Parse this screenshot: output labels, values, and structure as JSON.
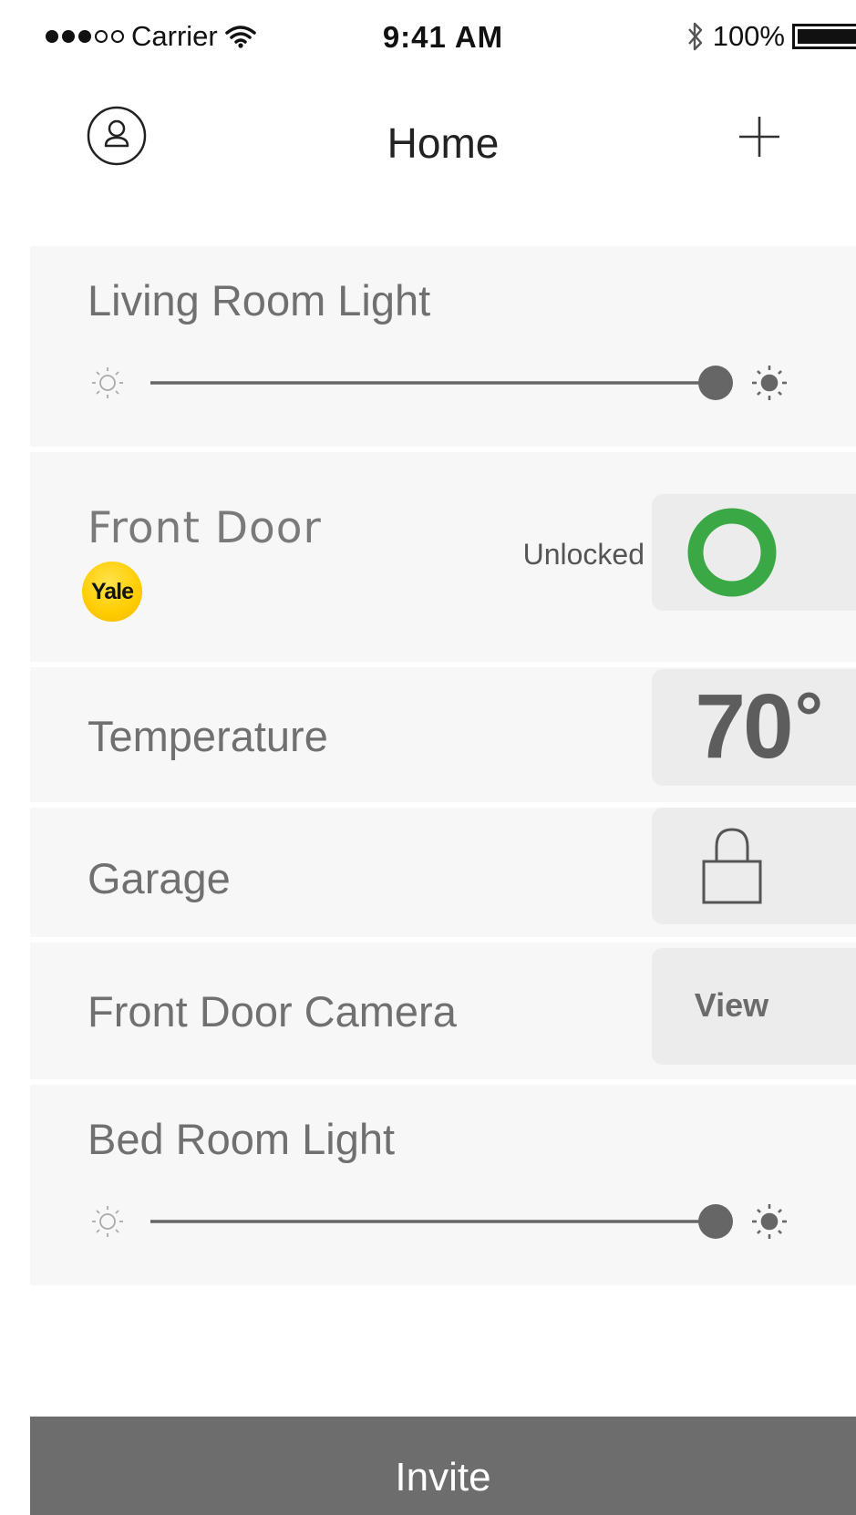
{
  "status_bar": {
    "carrier": "Carrier",
    "time": "9:41 AM",
    "battery": "100%",
    "signal_bars_filled": 3,
    "signal_bars_total": 5,
    "icons": [
      "wifi-icon",
      "bluetooth-icon",
      "battery-icon"
    ]
  },
  "nav": {
    "title": "Home",
    "left_icon": "profile-icon",
    "right_icon": "plus-icon"
  },
  "devices": {
    "living_room_light": {
      "label": "Living Room Light",
      "brightness": 1.0
    },
    "front_door": {
      "label": "Front Door",
      "status": "Unlocked",
      "brand": "Yale",
      "status_color": "#3aa845"
    },
    "temperature": {
      "label": "Temperature",
      "value": "70",
      "unit": "°"
    },
    "garage": {
      "label": "Garage",
      "icon": "padlock-icon"
    },
    "front_door_camera": {
      "label": "Front Door Camera",
      "action": "View"
    },
    "bed_room_light": {
      "label": "Bed Room Light",
      "brightness": 1.0
    }
  },
  "footer": {
    "invite_label": "Invite"
  },
  "colors": {
    "accent_green": "#3aa845",
    "footer_bg": "#6d6d6d",
    "row_bg": "#f7f7f7",
    "tile_bg": "#ececec",
    "yale_yellow": "#ffcc00"
  }
}
